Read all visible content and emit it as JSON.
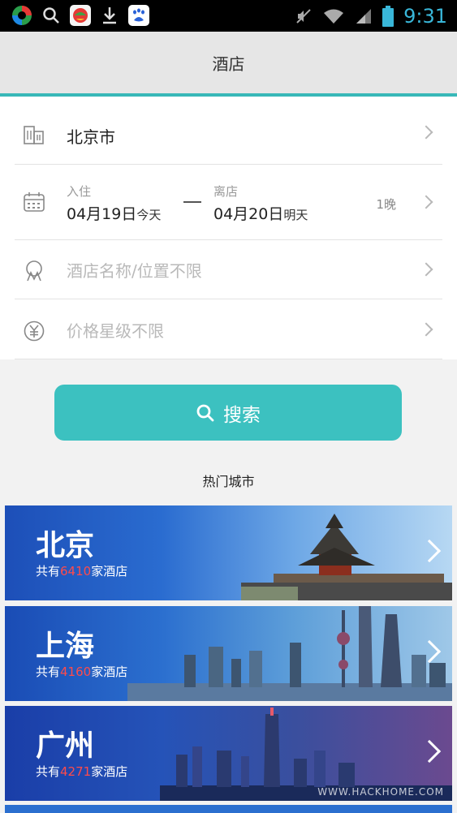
{
  "status_bar": {
    "time": "9:31",
    "icons": [
      "app-icon",
      "search-icon",
      "game-icon",
      "download-icon",
      "baidu-icon",
      "mute-icon",
      "wifi-icon",
      "signal-icon",
      "battery-icon"
    ],
    "time_color": "#39b7d9"
  },
  "header": {
    "title": "酒店"
  },
  "form": {
    "city": {
      "value": "北京市",
      "icon": "building-icon"
    },
    "dates": {
      "icon": "calendar-icon",
      "checkin_label": "入住",
      "checkin_date": "04月19日",
      "checkin_day": "今天",
      "checkout_label": "离店",
      "checkout_date": "04月20日",
      "checkout_day": "明天",
      "nights": "1晚"
    },
    "hotel_name": {
      "placeholder": "酒店名称/位置不限",
      "icon": "location-icon"
    },
    "price": {
      "placeholder": "价格星级不限",
      "icon": "yuan-icon"
    }
  },
  "search_button": {
    "label": "搜索"
  },
  "hot_cities": {
    "title": "热门城市",
    "count_prefix": "共有",
    "count_suffix": "家酒店",
    "items": [
      {
        "name": "北京",
        "count": "6410"
      },
      {
        "name": "上海",
        "count": "4160"
      },
      {
        "name": "广州",
        "count": "4271"
      }
    ],
    "watermark": "WWW.HACKHOME.COM"
  },
  "colors": {
    "accent": "#3cc1c0",
    "count_highlight": "#ff4b4b"
  }
}
